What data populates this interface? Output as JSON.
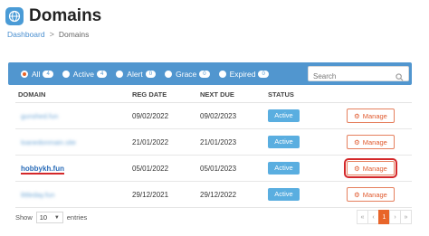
{
  "header": {
    "title": "Domains",
    "icon": "globe-icon"
  },
  "breadcrumb": {
    "home": "Dashboard",
    "separator": ">",
    "current": "Domains"
  },
  "filters": [
    {
      "label": "All",
      "count": "4",
      "checked": true
    },
    {
      "label": "Active",
      "count": "4",
      "checked": false
    },
    {
      "label": "Alert",
      "count": "0",
      "checked": false
    },
    {
      "label": "Grace",
      "count": "0",
      "checked": false
    },
    {
      "label": "Expired",
      "count": "0",
      "checked": false
    }
  ],
  "search": {
    "placeholder": "Search",
    "value": ""
  },
  "table": {
    "headers": {
      "domain": "DOMAIN",
      "reg_date": "REG DATE",
      "next_due": "NEXT DUE",
      "status": "STATUS"
    },
    "rows": [
      {
        "domain": "gunshed.fun",
        "blurred": true,
        "reg_date": "09/02/2022",
        "next_due": "09/02/2023",
        "status": "Active",
        "action": "Manage"
      },
      {
        "domain": "loanedonmain.site",
        "blurred": true,
        "reg_date": "21/01/2022",
        "next_due": "21/01/2023",
        "status": "Active",
        "action": "Manage"
      },
      {
        "domain": "hobbykh.fun",
        "blurred": false,
        "reg_date": "05/01/2022",
        "next_due": "05/01/2023",
        "status": "Active",
        "action": "Manage"
      },
      {
        "domain": "littleday.fun",
        "blurred": true,
        "reg_date": "29/12/2021",
        "next_due": "29/12/2022",
        "status": "Active",
        "action": "Manage"
      }
    ]
  },
  "footer": {
    "show_label": "Show",
    "page_size": "10",
    "entries_label": "entries"
  },
  "pagination": {
    "first": "«",
    "prev": "‹",
    "current": "1",
    "next": "›",
    "last": "»"
  },
  "colors": {
    "accent": "#5196cf",
    "active_badge": "#5aaee0",
    "manage_orange": "#e05a2e",
    "highlight_red": "#d4282a"
  }
}
